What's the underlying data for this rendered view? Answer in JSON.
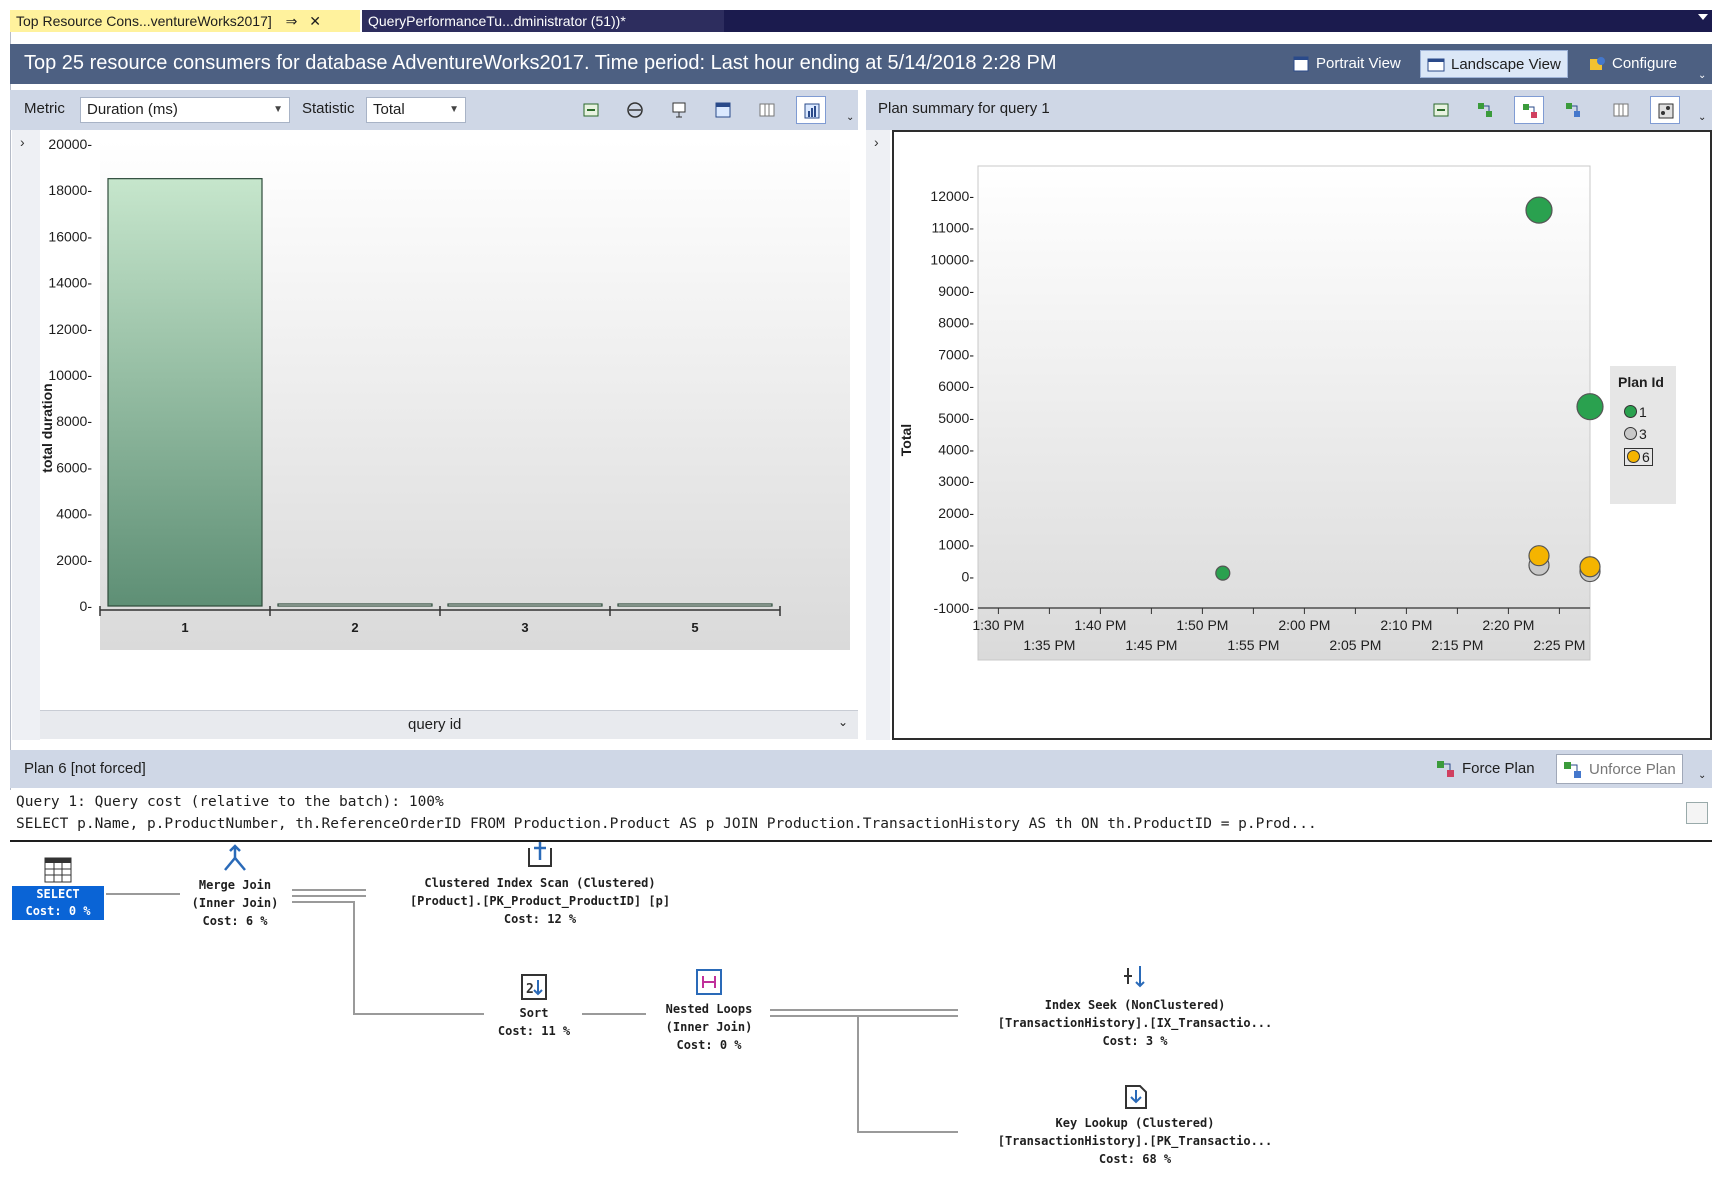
{
  "tabs": [
    {
      "label": "Top Resource Cons...ventureWorks2017]",
      "pin": "⇒",
      "close": "✕"
    },
    {
      "label": "QueryPerformanceTu...dministrator (51))*"
    }
  ],
  "header": {
    "title": "Top 25 resource consumers for database AdventureWorks2017. Time period: Last hour ending at 5/14/2018 2:28 PM",
    "buttons": {
      "portrait": "Portrait View",
      "landscape": "Landscape View",
      "configure": "Configure"
    }
  },
  "left_toolbar": {
    "metric_label": "Metric",
    "metric_value": "Duration (ms)",
    "statistic_label": "Statistic",
    "statistic_value": "Total"
  },
  "right_toolbar": {
    "title": "Plan summary for query 1"
  },
  "plan_header": {
    "label": "Plan 6 [not forced]",
    "force": "Force Plan",
    "unforce": "Unforce Plan"
  },
  "query": {
    "line1": "Query 1: Query cost (relative to the batch): 100%",
    "line2": "SELECT p.Name, p.ProductNumber, th.ReferenceOrderID FROM Production.Product AS p JOIN Production.TransactionHistory AS th ON th.ProductID = p.Prod..."
  },
  "plan_nodes": {
    "select": {
      "name": "SELECT",
      "cost": "Cost: 0 %"
    },
    "merge": {
      "name": "Merge Join",
      "sub": "(Inner Join)",
      "cost": "Cost: 6 %"
    },
    "scan": {
      "name": "Clustered Index Scan (Clustered)",
      "sub": "[Product].[PK_Product_ProductID] [p]",
      "cost": "Cost: 12 %"
    },
    "sort": {
      "name": "Sort",
      "cost": "Cost: 11 %"
    },
    "loops": {
      "name": "Nested Loops",
      "sub": "(Inner Join)",
      "cost": "Cost: 0 %"
    },
    "seek": {
      "name": "Index Seek (NonClustered)",
      "sub": "[TransactionHistory].[IX_Transactio...",
      "cost": "Cost: 3 %"
    },
    "lookup": {
      "name": "Key Lookup (Clustered)",
      "sub": "[TransactionHistory].[PK_Transactio...",
      "cost": "Cost: 68 %"
    }
  },
  "colors": {
    "green": "#2aa14f",
    "gray": "#c8c8c8",
    "orange": "#f5b400",
    "header": "#4d6082"
  },
  "chart_data": [
    {
      "type": "bar",
      "categories": [
        "1",
        "2",
        "3",
        "5"
      ],
      "values": [
        18500,
        30,
        30,
        60
      ],
      "xlabel": "query id",
      "ylabel": "total duration",
      "ylim": [
        0,
        20000
      ],
      "yticks": [
        0,
        2000,
        4000,
        6000,
        8000,
        10000,
        12000,
        14000,
        16000,
        18000,
        20000
      ]
    },
    {
      "type": "scatter",
      "ylabel": "Total",
      "ylim": [
        -1000,
        12500
      ],
      "yticks": [
        -1000,
        0,
        1000,
        2000,
        3000,
        4000,
        5000,
        6000,
        7000,
        8000,
        9000,
        10000,
        11000,
        12000
      ],
      "xticks_top": [
        "1:30 PM",
        "1:40 PM",
        "1:50 PM",
        "2:00 PM",
        "2:10 PM",
        "2:20 PM"
      ],
      "xticks_bottom": [
        "1:35 PM",
        "1:45 PM",
        "1:55 PM",
        "2:05 PM",
        "2:15 PM",
        "2:25 PM"
      ],
      "xlim": [
        "1:28 PM",
        "2:28 PM"
      ],
      "legend_title": "Plan Id",
      "legend_position": "right",
      "series": [
        {
          "name": "1",
          "color": "#2aa14f",
          "points": [
            {
              "x": "1:52 PM",
              "y": 100
            },
            {
              "x": "2:23 PM",
              "y": 11550
            },
            {
              "x": "2:28 PM",
              "y": 5350
            }
          ]
        },
        {
          "name": "3",
          "color": "#c8c8c8",
          "points": [
            {
              "x": "2:23 PM",
              "y": 350
            },
            {
              "x": "2:28 PM",
              "y": 150
            }
          ]
        },
        {
          "name": "6",
          "color": "#f5b400",
          "points": [
            {
              "x": "2:23 PM",
              "y": 650
            },
            {
              "x": "2:28 PM",
              "y": 300
            }
          ]
        }
      ]
    }
  ]
}
